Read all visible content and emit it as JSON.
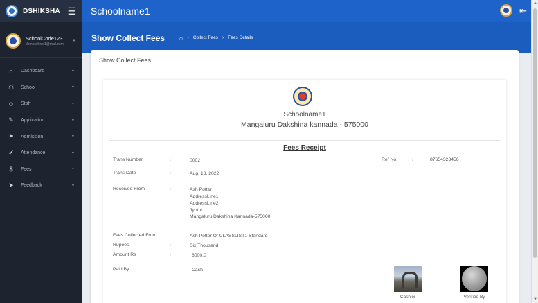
{
  "sidebar": {
    "brand": "DSHIKSHA",
    "hamburger_icon": "menu-icon",
    "profile": {
      "name": "SchoolCode123",
      "email": "demoschool1@mail.com"
    },
    "items": [
      {
        "label": "Dashboard",
        "icon": "dashboard-icon",
        "glyph": "⌂"
      },
      {
        "label": "School",
        "icon": "school-icon",
        "glyph": "☖"
      },
      {
        "label": "Staff",
        "icon": "staff-icon",
        "glyph": "☺"
      },
      {
        "label": "Application",
        "icon": "application-icon",
        "glyph": "✎"
      },
      {
        "label": "Admission",
        "icon": "admission-icon",
        "glyph": "⚑"
      },
      {
        "label": "Attendance",
        "icon": "attendance-icon",
        "glyph": "✔"
      },
      {
        "label": "Fees",
        "icon": "dollar-icon",
        "glyph": "$"
      },
      {
        "label": "Feedback",
        "icon": "feedback-icon",
        "glyph": "➤"
      }
    ]
  },
  "topbar": {
    "title": "Schoolname1"
  },
  "page_header": {
    "title": "Show Collect Fees",
    "breadcrumb": [
      "Collect Fees",
      "Fees Details"
    ]
  },
  "card": {
    "title": "Show Collect Fees"
  },
  "receipt": {
    "school_name": "Schoolname1",
    "school_address": "Mangaluru Dakshina kannada - 575000",
    "heading": "Fees Receipt",
    "trans_number": {
      "label": "Trans Number",
      "value": "0002"
    },
    "ref_no": {
      "label": "Ref No.",
      "value": "87654323456"
    },
    "trans_date": {
      "label": "Trans Date",
      "value": "Aug. 18, 2022"
    },
    "received_from": {
      "label": "Received From",
      "lines": [
        "Ash Potter",
        "AddressLine1",
        "AddressLine2",
        "Jyothi",
        "Mangaluru Dakshina Kannada-575000"
      ]
    },
    "fees_collected_from": {
      "label": "Fees Collected From",
      "value": "Ash Potter Of CLASSLIST1 Standard"
    },
    "rupees": {
      "label": "Rupees",
      "value": "Six Thousand"
    },
    "amount": {
      "label": "Amount Rs",
      "value": "6000.0"
    },
    "paid_by": {
      "label": "Paid By",
      "value": "Cash"
    },
    "colon": ":",
    "signatures": {
      "cashier": "Cashier",
      "verified": "Verified By"
    }
  }
}
